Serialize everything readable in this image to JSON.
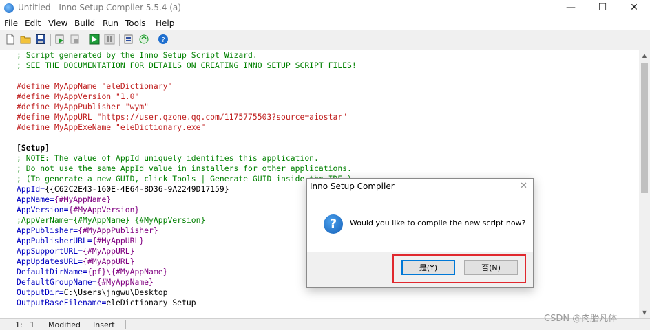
{
  "window": {
    "title": "Untitled - Inno Setup Compiler 5.5.4 (a)",
    "minimize_glyph": "—",
    "maximize_glyph": "☐",
    "close_glyph": "✕"
  },
  "menu": [
    "File",
    "Edit",
    "View",
    "Build",
    "Run",
    "Tools",
    "Help"
  ],
  "toolbar_icons": [
    "new-file-icon",
    "open-folder-icon",
    "save-icon",
    "compile-icon",
    "stop-compile-icon",
    "run-icon",
    "pause-icon",
    "target-setup-icon",
    "refresh-icon",
    "help-icon"
  ],
  "code_lines": [
    {
      "text": "; Script generated by the Inno Setup Script Wizard.",
      "kind": "comment"
    },
    {
      "text": "; SEE THE DOCUMENTATION FOR DETAILS ON CREATING INNO SETUP SCRIPT FILES!",
      "kind": "comment"
    },
    {
      "text": "",
      "kind": "plain"
    },
    {
      "text": "#define MyAppName \"eleDictionary\"",
      "kind": "define"
    },
    {
      "text": "#define MyAppVersion \"1.0\"",
      "kind": "define"
    },
    {
      "text": "#define MyAppPublisher \"wym\"",
      "kind": "define"
    },
    {
      "text": "#define MyAppURL \"https://user.qzone.qq.com/1175775503?source=aiostar\"",
      "kind": "define"
    },
    {
      "text": "#define MyAppExeName \"eleDictionary.exe\"",
      "kind": "define"
    },
    {
      "text": "",
      "kind": "plain"
    },
    {
      "text": "[Setup]",
      "kind": "section"
    },
    {
      "text": "; NOTE: The value of AppId uniquely identifies this application.",
      "kind": "comment"
    },
    {
      "text": "; Do not use the same AppId value in installers for other applications.",
      "kind": "comment"
    },
    {
      "text": "; (To generate a new GUID, click Tools | Generate GUID inside the IDE.)",
      "kind": "comment"
    },
    {
      "key": "AppId=",
      "value": "{{C62C2E43-160E-4E64-BD36-9A2249D17159}",
      "kind": "keyvalue_plain"
    },
    {
      "key": "AppName=",
      "value": "{#MyAppName}",
      "kind": "keyvalue"
    },
    {
      "key": "AppVersion=",
      "value": "{#MyAppVersion}",
      "kind": "keyvalue"
    },
    {
      "text": ";AppVerName={#MyAppName} {#MyAppVersion}",
      "kind": "comment"
    },
    {
      "key": "AppPublisher=",
      "value": "{#MyAppPublisher}",
      "kind": "keyvalue"
    },
    {
      "key": "AppPublisherURL=",
      "value": "{#MyAppURL}",
      "kind": "keyvalue"
    },
    {
      "key": "AppSupportURL=",
      "value": "{#MyAppURL}",
      "kind": "keyvalue"
    },
    {
      "key": "AppUpdatesURL=",
      "value": "{#MyAppURL}",
      "kind": "keyvalue"
    },
    {
      "key": "DefaultDirName=",
      "value": "{pf}\\{#MyAppName}",
      "kind": "keyvalue"
    },
    {
      "key": "DefaultGroupName=",
      "value": "{#MyAppName}",
      "kind": "keyvalue"
    },
    {
      "key": "OutputDir=",
      "value": "C:\\Users\\jngwu\\Desktop",
      "kind": "keyvalue_plain"
    },
    {
      "key": "OutputBaseFilename=",
      "value": "eleDictionary Setup",
      "kind": "keyvalue_plain"
    }
  ],
  "status": {
    "position": "1:   1",
    "modified": "Modified",
    "mode": "Insert"
  },
  "watermark": "CSDN @肉胎凡体",
  "dialog": {
    "title": "Inno Setup Compiler",
    "close_glyph": "✕",
    "icon_glyph": "?",
    "message": "Would you like to compile the new script now?",
    "yes_label": "是(Y)",
    "no_label": "否(N)"
  },
  "colors": {
    "comment": "#008000",
    "define": "#c02020",
    "key": "#0000c0",
    "const": "#800080",
    "highlight": "#e0282e"
  }
}
